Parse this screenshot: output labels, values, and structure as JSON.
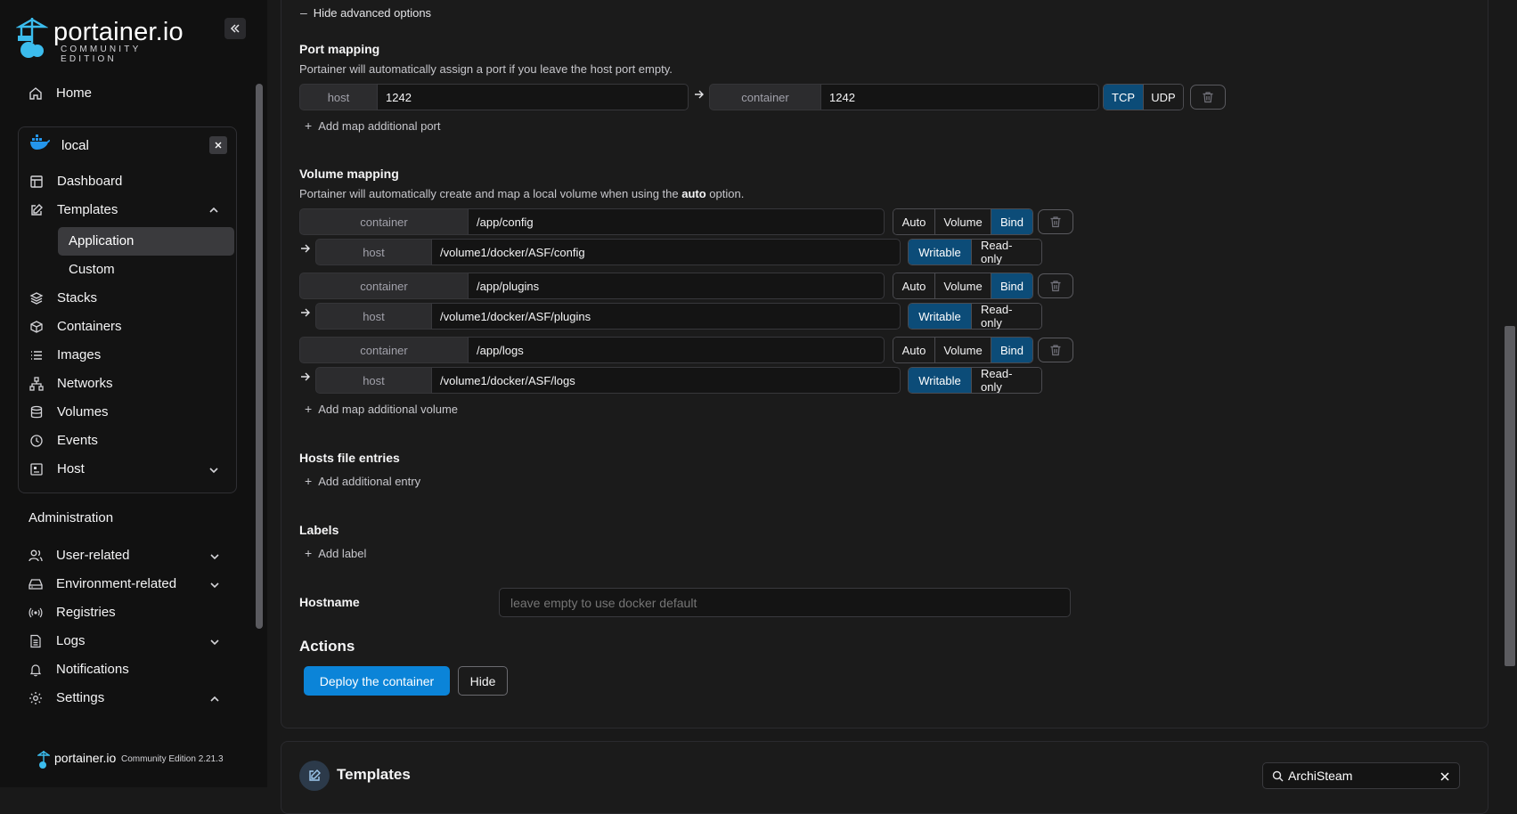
{
  "sidebar": {
    "logo_word": "portainer.io",
    "logo_sub": "COMMUNITY EDITION",
    "home": "Home",
    "environment": {
      "name": "local",
      "items": [
        {
          "label": "Dashboard",
          "icon": "dashboard-icon"
        },
        {
          "label": "Templates",
          "icon": "edit-icon"
        },
        {
          "label": "Application",
          "icon": ""
        },
        {
          "label": "Custom",
          "icon": ""
        },
        {
          "label": "Stacks",
          "icon": "layers-icon"
        },
        {
          "label": "Containers",
          "icon": "box-icon"
        },
        {
          "label": "Images",
          "icon": "list-icon"
        },
        {
          "label": "Networks",
          "icon": "network-icon"
        },
        {
          "label": "Volumes",
          "icon": "database-icon"
        },
        {
          "label": "Events",
          "icon": "clock-icon"
        },
        {
          "label": "Host",
          "icon": "host-icon"
        }
      ]
    },
    "admin_title": "Administration",
    "admin_items": [
      {
        "label": "User-related"
      },
      {
        "label": "Environment-related"
      },
      {
        "label": "Registries"
      },
      {
        "label": "Logs"
      },
      {
        "label": "Notifications"
      },
      {
        "label": "Settings"
      }
    ],
    "footer_logo": "portainer.io",
    "footer_edition": "Community Edition 2.21.3"
  },
  "form": {
    "hide_advanced": "Hide advanced options",
    "port_mapping": {
      "title": "Port mapping",
      "help": "Portainer will automatically assign a port if you leave the host port empty.",
      "host_label": "host",
      "host_value": "1242",
      "container_label": "container",
      "container_value": "1242",
      "protocols": [
        "TCP",
        "UDP"
      ],
      "selected_protocol": "TCP",
      "add_link": "Add map additional port"
    },
    "volume_mapping": {
      "title": "Volume mapping",
      "help_pre": "Portainer will automatically create and map a local volume when using the ",
      "help_bold": "auto",
      "help_post": " option.",
      "container_label": "container",
      "host_label": "host",
      "type_options": [
        "Auto",
        "Volume",
        "Bind"
      ],
      "mode_options": [
        "Writable",
        "Read-only"
      ],
      "rows": [
        {
          "container": "/app/config",
          "host": "/volume1/docker/ASF/config",
          "type": "Bind",
          "mode": "Writable"
        },
        {
          "container": "/app/plugins",
          "host": "/volume1/docker/ASF/plugins",
          "type": "Bind",
          "mode": "Writable"
        },
        {
          "container": "/app/logs",
          "host": "/volume1/docker/ASF/logs",
          "type": "Bind",
          "mode": "Writable"
        }
      ],
      "add_link": "Add map additional volume"
    },
    "hosts_file": {
      "title": "Hosts file entries",
      "add_link": "Add additional entry"
    },
    "labels": {
      "title": "Labels",
      "add_link": "Add label"
    },
    "hostname": {
      "label": "Hostname",
      "placeholder": "leave empty to use docker default"
    },
    "actions": {
      "title": "Actions",
      "deploy": "Deploy the container",
      "hide": "Hide"
    }
  },
  "templates_panel": {
    "title": "Templates",
    "search_value": "ArchiSteam"
  },
  "colors": {
    "accent": "#0b84d8",
    "toggle_active": "#0c4c78"
  }
}
